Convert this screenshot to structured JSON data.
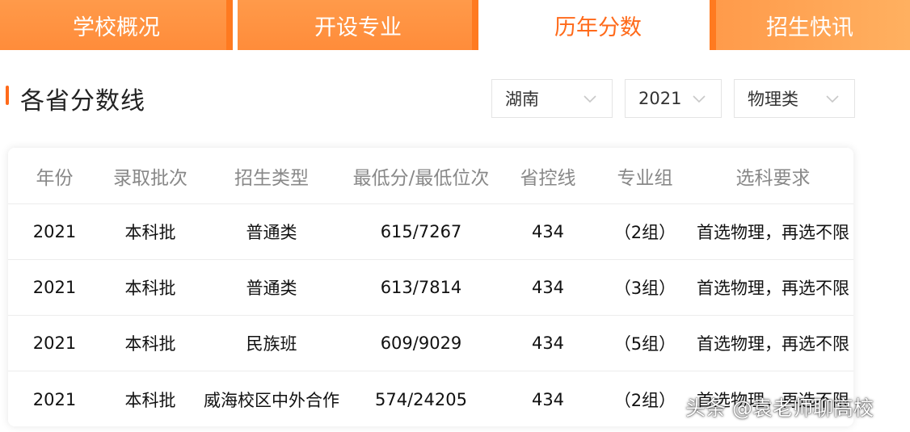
{
  "tabs": [
    {
      "label": "学校概况"
    },
    {
      "label": "开设专业"
    },
    {
      "label": "历年分数"
    },
    {
      "label": "招生快讯"
    }
  ],
  "section": {
    "title": "各省分数线"
  },
  "filters": {
    "province": "湖南",
    "year": "2021",
    "subject_type": "物理类"
  },
  "table": {
    "headers": [
      "年份",
      "录取批次",
      "招生类型",
      "最低分/最低位次",
      "省控线",
      "专业组",
      "选科要求"
    ],
    "rows": [
      [
        "2021",
        "本科批",
        "普通类",
        "615/7267",
        "434",
        "（2组）",
        "首选物理，再选不限"
      ],
      [
        "2021",
        "本科批",
        "普通类",
        "613/7814",
        "434",
        "（3组）",
        "首选物理，再选不限"
      ],
      [
        "2021",
        "本科批",
        "民族班",
        "609/9029",
        "434",
        "（5组）",
        "首选物理，再选不限"
      ],
      [
        "2021",
        "本科批",
        "威海校区中外合作",
        "574/24205",
        "434",
        "（2组）",
        "首选物理，再选不限"
      ]
    ]
  },
  "watermark": "头条 @袁老师聊高校",
  "colors": {
    "accent": "#ff6a1a",
    "tab_bg": "#ff8c3a"
  }
}
